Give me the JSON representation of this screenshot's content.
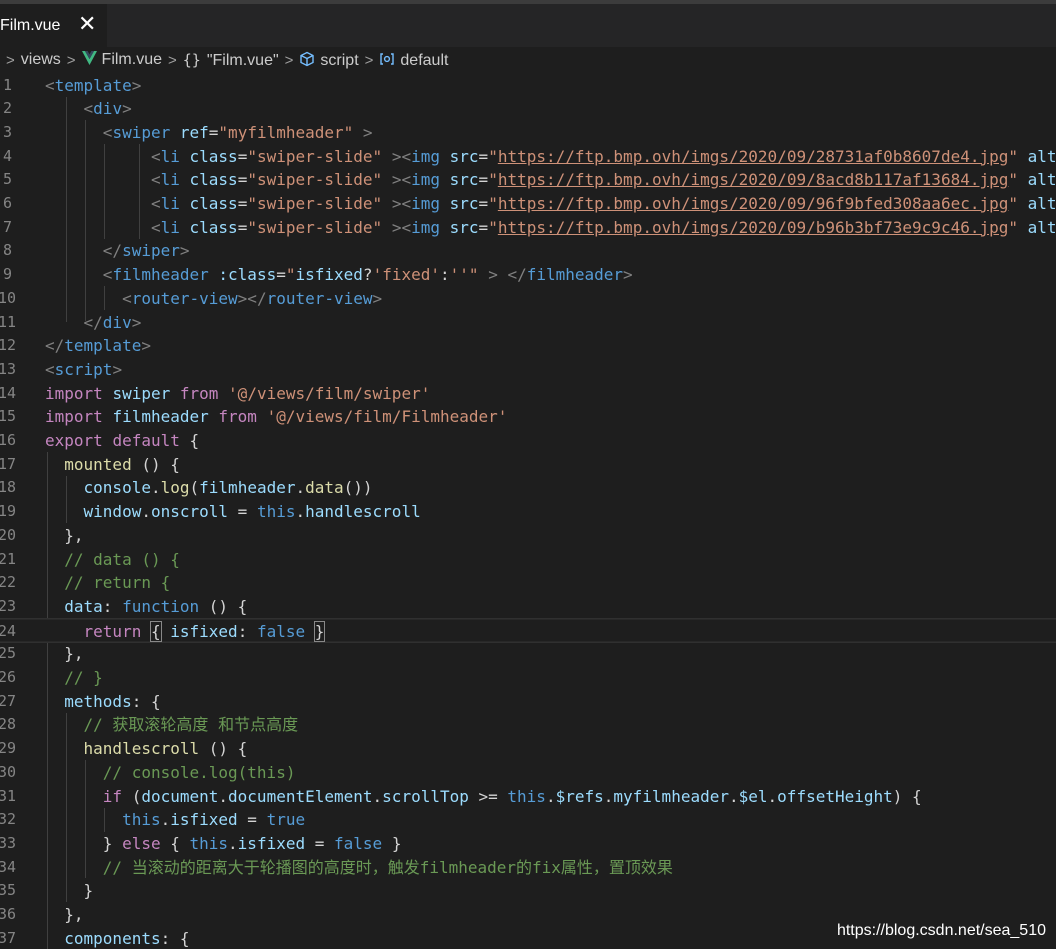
{
  "tab": {
    "label": "Film.vue",
    "close_glyph": "✕"
  },
  "breadcrumb": {
    "lead_sep": ">",
    "items": [
      "views",
      "Film.vue",
      "\"Film.vue\"",
      "script",
      "default"
    ],
    "sep": ">",
    "icons": [
      "vue-icon",
      "braces-icon",
      "cube-icon",
      "symbol-icon"
    ],
    "braces_glyph": "{}"
  },
  "editor": {
    "lines": [
      {
        "n": "1",
        "tokens": [
          [
            "tg",
            "<"
          ],
          [
            "tn",
            "template"
          ],
          [
            "tg",
            ">"
          ]
        ]
      },
      {
        "n": "2",
        "tokens": [
          [
            "pl",
            "    "
          ],
          [
            "tg",
            "<"
          ],
          [
            "tn",
            "div"
          ],
          [
            "tg",
            ">"
          ]
        ]
      },
      {
        "n": "3",
        "tokens": [
          [
            "pl",
            "      "
          ],
          [
            "tg",
            "<"
          ],
          [
            "tn",
            "swiper"
          ],
          [
            "pl",
            " "
          ],
          [
            "at",
            "ref"
          ],
          [
            "pl",
            "="
          ],
          [
            "st",
            "\"myfilmheader\""
          ],
          [
            "pl",
            " "
          ],
          [
            "tg",
            ">"
          ]
        ]
      },
      {
        "n": "4",
        "tokens": [
          [
            "pl",
            "           "
          ],
          [
            "tg",
            "<"
          ],
          [
            "tn",
            "li"
          ],
          [
            "pl",
            " "
          ],
          [
            "at",
            "class"
          ],
          [
            "pl",
            "="
          ],
          [
            "st",
            "\"swiper-slide\""
          ],
          [
            "pl",
            " "
          ],
          [
            "tg",
            "><"
          ],
          [
            "tn",
            "img"
          ],
          [
            "pl",
            " "
          ],
          [
            "at",
            "src"
          ],
          [
            "pl",
            "="
          ],
          [
            "st",
            "\""
          ],
          [
            "url",
            "https://ftp.bmp.ovh/imgs/2020/09/28731af0b8607de4.jpg"
          ],
          [
            "st",
            "\""
          ],
          [
            "pl",
            " "
          ],
          [
            "at",
            "alt"
          ]
        ]
      },
      {
        "n": "5",
        "tokens": [
          [
            "pl",
            "           "
          ],
          [
            "tg",
            "<"
          ],
          [
            "tn",
            "li"
          ],
          [
            "pl",
            " "
          ],
          [
            "at",
            "class"
          ],
          [
            "pl",
            "="
          ],
          [
            "st",
            "\"swiper-slide\""
          ],
          [
            "pl",
            " "
          ],
          [
            "tg",
            "><"
          ],
          [
            "tn",
            "img"
          ],
          [
            "pl",
            " "
          ],
          [
            "at",
            "src"
          ],
          [
            "pl",
            "="
          ],
          [
            "st",
            "\""
          ],
          [
            "url",
            "https://ftp.bmp.ovh/imgs/2020/09/8acd8b117af13684.jpg"
          ],
          [
            "st",
            "\""
          ],
          [
            "pl",
            " "
          ],
          [
            "at",
            "alt"
          ]
        ]
      },
      {
        "n": "6",
        "tokens": [
          [
            "pl",
            "           "
          ],
          [
            "tg",
            "<"
          ],
          [
            "tn",
            "li"
          ],
          [
            "pl",
            " "
          ],
          [
            "at",
            "class"
          ],
          [
            "pl",
            "="
          ],
          [
            "st",
            "\"swiper-slide\""
          ],
          [
            "pl",
            " "
          ],
          [
            "tg",
            "><"
          ],
          [
            "tn",
            "img"
          ],
          [
            "pl",
            " "
          ],
          [
            "at",
            "src"
          ],
          [
            "pl",
            "="
          ],
          [
            "st",
            "\""
          ],
          [
            "url",
            "https://ftp.bmp.ovh/imgs/2020/09/96f9bfed308aa6ec.jpg"
          ],
          [
            "st",
            "\""
          ],
          [
            "pl",
            " "
          ],
          [
            "at",
            "alt"
          ]
        ]
      },
      {
        "n": "7",
        "tokens": [
          [
            "pl",
            "           "
          ],
          [
            "tg",
            "<"
          ],
          [
            "tn",
            "li"
          ],
          [
            "pl",
            " "
          ],
          [
            "at",
            "class"
          ],
          [
            "pl",
            "="
          ],
          [
            "st",
            "\"swiper-slide\""
          ],
          [
            "pl",
            " "
          ],
          [
            "tg",
            "><"
          ],
          [
            "tn",
            "img"
          ],
          [
            "pl",
            " "
          ],
          [
            "at",
            "src"
          ],
          [
            "pl",
            "="
          ],
          [
            "st",
            "\""
          ],
          [
            "url",
            "https://ftp.bmp.ovh/imgs/2020/09/b96b3bf73e9c9c46.jpg"
          ],
          [
            "st",
            "\""
          ],
          [
            "pl",
            " "
          ],
          [
            "at",
            "alt"
          ]
        ]
      },
      {
        "n": "8",
        "tokens": [
          [
            "pl",
            "      "
          ],
          [
            "tg",
            "</"
          ],
          [
            "tn",
            "swiper"
          ],
          [
            "tg",
            ">"
          ]
        ]
      },
      {
        "n": "9",
        "tokens": [
          [
            "pl",
            "      "
          ],
          [
            "tg",
            "<"
          ],
          [
            "tn",
            "filmheader"
          ],
          [
            "pl",
            " "
          ],
          [
            "at",
            ":class"
          ],
          [
            "pl",
            "="
          ],
          [
            "st",
            "\""
          ],
          [
            "vr",
            "isfixed"
          ],
          [
            "pl",
            "?"
          ],
          [
            "st",
            "'fixed'"
          ],
          [
            "pl",
            ":"
          ],
          [
            "st",
            "''"
          ],
          [
            "st",
            "\""
          ],
          [
            "pl",
            " "
          ],
          [
            "tg",
            "> </"
          ],
          [
            "tn",
            "filmheader"
          ],
          [
            "tg",
            ">"
          ]
        ]
      },
      {
        "n": "10",
        "tokens": [
          [
            "pl",
            "        "
          ],
          [
            "tg",
            "<"
          ],
          [
            "tn",
            "router-view"
          ],
          [
            "tg",
            "></"
          ],
          [
            "tn",
            "router-view"
          ],
          [
            "tg",
            ">"
          ]
        ]
      },
      {
        "n": "11",
        "tokens": [
          [
            "pl",
            "    "
          ],
          [
            "tg",
            "</"
          ],
          [
            "tn",
            "div"
          ],
          [
            "tg",
            ">"
          ]
        ]
      },
      {
        "n": "12",
        "tokens": [
          [
            "tg",
            "</"
          ],
          [
            "tn",
            "template"
          ],
          [
            "tg",
            ">"
          ]
        ]
      },
      {
        "n": "13",
        "tokens": [
          [
            "tg",
            "<"
          ],
          [
            "tn",
            "script"
          ],
          [
            "tg",
            ">"
          ]
        ]
      },
      {
        "n": "14",
        "tokens": [
          [
            "kw",
            "import"
          ],
          [
            "pl",
            " "
          ],
          [
            "vr",
            "swiper"
          ],
          [
            "pl",
            " "
          ],
          [
            "kw",
            "from"
          ],
          [
            "pl",
            " "
          ],
          [
            "st",
            "'@/views/film/swiper'"
          ]
        ]
      },
      {
        "n": "15",
        "tokens": [
          [
            "kw",
            "import"
          ],
          [
            "pl",
            " "
          ],
          [
            "vr",
            "filmheader"
          ],
          [
            "pl",
            " "
          ],
          [
            "kw",
            "from"
          ],
          [
            "pl",
            " "
          ],
          [
            "st",
            "'@/views/film/Filmheader'"
          ]
        ]
      },
      {
        "n": "16",
        "tokens": [
          [
            "kw",
            "export"
          ],
          [
            "pl",
            " "
          ],
          [
            "kw",
            "default"
          ],
          [
            "pl",
            " {"
          ]
        ]
      },
      {
        "n": "17",
        "tokens": [
          [
            "pl",
            "  "
          ],
          [
            "fn",
            "mounted"
          ],
          [
            "pl",
            " () {"
          ]
        ]
      },
      {
        "n": "18",
        "tokens": [
          [
            "pl",
            "    "
          ],
          [
            "vr",
            "console"
          ],
          [
            "pl",
            "."
          ],
          [
            "fn",
            "log"
          ],
          [
            "pl",
            "("
          ],
          [
            "vr",
            "filmheader"
          ],
          [
            "pl",
            "."
          ],
          [
            "fn",
            "data"
          ],
          [
            "pl",
            "())"
          ]
        ]
      },
      {
        "n": "19",
        "tokens": [
          [
            "pl",
            "    "
          ],
          [
            "vr",
            "window"
          ],
          [
            "pl",
            "."
          ],
          [
            "vr",
            "onscroll"
          ],
          [
            "pl",
            " = "
          ],
          [
            "kb",
            "this"
          ],
          [
            "pl",
            "."
          ],
          [
            "vr",
            "handlescroll"
          ]
        ]
      },
      {
        "n": "20",
        "tokens": [
          [
            "pl",
            "  },"
          ]
        ]
      },
      {
        "n": "21",
        "tokens": [
          [
            "pl",
            "  "
          ],
          [
            "cm",
            "// data () {"
          ]
        ]
      },
      {
        "n": "22",
        "tokens": [
          [
            "pl",
            "  "
          ],
          [
            "cm",
            "// return {"
          ]
        ]
      },
      {
        "n": "23",
        "tokens": [
          [
            "pl",
            "  "
          ],
          [
            "vr",
            "data"
          ],
          [
            "pl",
            ": "
          ],
          [
            "kb",
            "function"
          ],
          [
            "pl",
            " () {"
          ]
        ]
      },
      {
        "n": "24",
        "tokens": [
          [
            "pl",
            "    "
          ],
          [
            "kw",
            "return"
          ],
          [
            "pl",
            " "
          ],
          [
            "pl",
            "{"
          ],
          [
            "pl",
            " "
          ],
          [
            "vr",
            "isfixed"
          ],
          [
            "pl",
            ": "
          ],
          [
            "kb",
            "false"
          ],
          [
            "pl",
            " "
          ],
          [
            "pl",
            "}"
          ]
        ]
      },
      {
        "n": "25",
        "tokens": [
          [
            "pl",
            "  },"
          ]
        ]
      },
      {
        "n": "26",
        "tokens": [
          [
            "pl",
            "  "
          ],
          [
            "cm",
            "// }"
          ]
        ]
      },
      {
        "n": "27",
        "tokens": [
          [
            "pl",
            "  "
          ],
          [
            "vr",
            "methods"
          ],
          [
            "pl",
            ": {"
          ]
        ]
      },
      {
        "n": "28",
        "tokens": [
          [
            "pl",
            "    "
          ],
          [
            "cm",
            "// 获取滚轮高度 和节点高度"
          ]
        ]
      },
      {
        "n": "29",
        "tokens": [
          [
            "pl",
            "    "
          ],
          [
            "fn",
            "handlescroll"
          ],
          [
            "pl",
            " () {"
          ]
        ]
      },
      {
        "n": "30",
        "tokens": [
          [
            "pl",
            "      "
          ],
          [
            "cm",
            "// console.log(this)"
          ]
        ]
      },
      {
        "n": "31",
        "tokens": [
          [
            "pl",
            "      "
          ],
          [
            "kw",
            "if"
          ],
          [
            "pl",
            " ("
          ],
          [
            "vr",
            "document"
          ],
          [
            "pl",
            "."
          ],
          [
            "vr",
            "documentElement"
          ],
          [
            "pl",
            "."
          ],
          [
            "vr",
            "scrollTop"
          ],
          [
            "pl",
            " >= "
          ],
          [
            "kb",
            "this"
          ],
          [
            "pl",
            "."
          ],
          [
            "vr",
            "$refs"
          ],
          [
            "pl",
            "."
          ],
          [
            "vr",
            "myfilmheader"
          ],
          [
            "pl",
            "."
          ],
          [
            "vr",
            "$el"
          ],
          [
            "pl",
            "."
          ],
          [
            "vr",
            "offsetHeight"
          ],
          [
            "pl",
            ") {"
          ]
        ]
      },
      {
        "n": "32",
        "tokens": [
          [
            "pl",
            "        "
          ],
          [
            "kb",
            "this"
          ],
          [
            "pl",
            "."
          ],
          [
            "vr",
            "isfixed"
          ],
          [
            "pl",
            " = "
          ],
          [
            "kb",
            "true"
          ]
        ]
      },
      {
        "n": "33",
        "tokens": [
          [
            "pl",
            "      } "
          ],
          [
            "kw",
            "else"
          ],
          [
            "pl",
            " { "
          ],
          [
            "kb",
            "this"
          ],
          [
            "pl",
            "."
          ],
          [
            "vr",
            "isfixed"
          ],
          [
            "pl",
            " = "
          ],
          [
            "kb",
            "false"
          ],
          [
            "pl",
            " }"
          ]
        ]
      },
      {
        "n": "34",
        "tokens": [
          [
            "pl",
            "      "
          ],
          [
            "cm",
            "// 当滚动的距离大于轮播图的高度时，触发filmheader的fix属性，置顶效果"
          ]
        ]
      },
      {
        "n": "35",
        "tokens": [
          [
            "pl",
            "    }"
          ]
        ]
      },
      {
        "n": "36",
        "tokens": [
          [
            "pl",
            "  },"
          ]
        ]
      },
      {
        "n": "37",
        "tokens": [
          [
            "pl",
            "  "
          ],
          [
            "vr",
            "components"
          ],
          [
            "pl",
            ": {"
          ]
        ]
      }
    ],
    "current_line": "24"
  },
  "watermark": "https://blog.csdn.net/sea_510"
}
